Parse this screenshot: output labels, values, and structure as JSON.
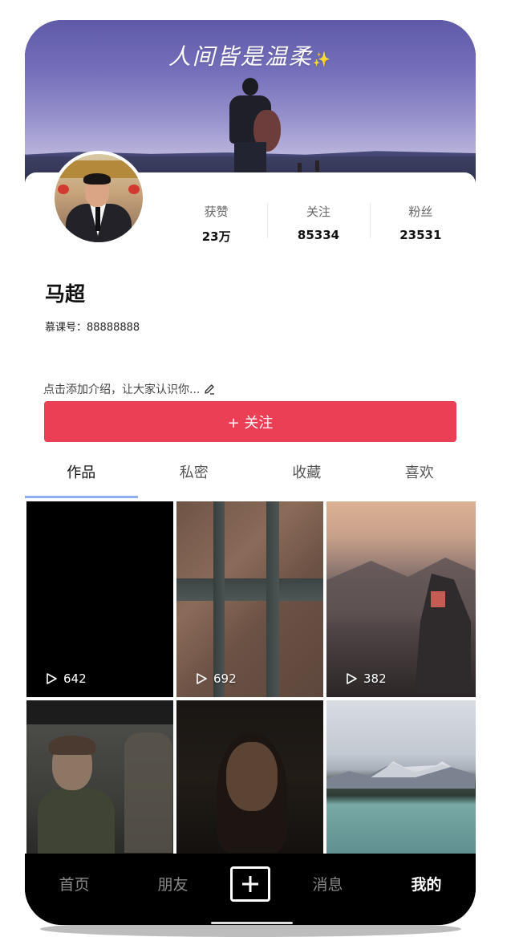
{
  "banner": {
    "title": "人间皆是温柔",
    "sparkle": "✨"
  },
  "profile": {
    "name": "马超",
    "account_id": "慕课号：88888888",
    "bio_placeholder": "点击添加介绍，让大家认识你...",
    "stats": [
      {
        "label": "获赞",
        "value": "23万"
      },
      {
        "label": "关注",
        "value": "85334"
      },
      {
        "label": "粉丝",
        "value": "23531"
      }
    ],
    "follow_label": "+ 关注"
  },
  "tabs": [
    {
      "label": "作品",
      "active": true
    },
    {
      "label": "私密",
      "active": false
    },
    {
      "label": "收藏",
      "active": false
    },
    {
      "label": "喜欢",
      "active": false
    }
  ],
  "videos": [
    {
      "plays": "642"
    },
    {
      "plays": "692"
    },
    {
      "plays": "382"
    },
    {
      "plays": ""
    },
    {
      "plays": ""
    },
    {
      "plays": ""
    }
  ],
  "bottom_nav": {
    "items": [
      "首页",
      "朋友",
      "消息",
      "我的"
    ],
    "active": "我的",
    "add_icon": "plus-icon"
  },
  "colors": {
    "accent": "#ea3f55",
    "tab_indicator": "#8faef0",
    "nav_background": "#000000"
  }
}
